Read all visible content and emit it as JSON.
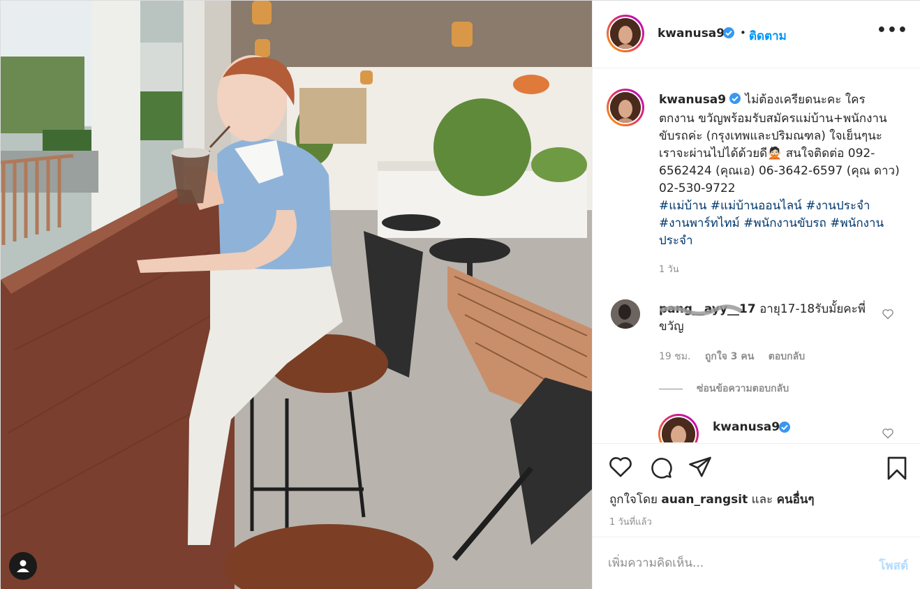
{
  "header": {
    "username": "kwanusa9",
    "separator": "•",
    "follow_label": "ติดตาม",
    "more_label": "•••"
  },
  "caption": {
    "username": "kwanusa9",
    "text": "ไม่ต้องเครียดนะคะ ใครตกงาน ขวัญพร้อมรับสมัครแม่บ้าน+พนักงานขับรถค่ะ (กรุงเทพและปริมณฑล) ใจเย็นๆนะ เราจะผ่านไปได้ด้วยดี🙅🏻 สนใจติดต่อ 092-6562424 (คุณเอ) 06-3642-6597 (คุณ ดาว) 02-530-9722",
    "hashtags": [
      "#แม่บ้าน",
      "#แม่บ้านออนไลน์",
      "#งานประจำ",
      "#งานพาร์ทไทม์",
      "#พนักงานขับรถ",
      "#พนักงานประจำ"
    ],
    "time": "1 วัน"
  },
  "comment": {
    "username": "pang__ayy__17",
    "text": "อายุ17-18รับมั้ยคะพี่ขวัญ",
    "time": "19 ชม.",
    "likes": "ถูกใจ 3 คน",
    "reply_label": "ตอบกลับ",
    "hide_replies": "ซ่อนข้อความตอบกลับ"
  },
  "reply": {
    "username": "kwanusa9"
  },
  "likes": {
    "prefix": "ถูกใจโดย",
    "user": "auan_rangsit",
    "and": "และ",
    "others": "คนอื่นๆ"
  },
  "posted": "1 วันที่แล้ว",
  "add_comment": {
    "placeholder": "เพิ่มความคิดเห็น...",
    "post_label": "โพสต์"
  },
  "colors": {
    "link": "#0095f6",
    "hashtag": "#00376b",
    "muted": "#8e8e8e",
    "post_disabled": "#b3dbff"
  }
}
